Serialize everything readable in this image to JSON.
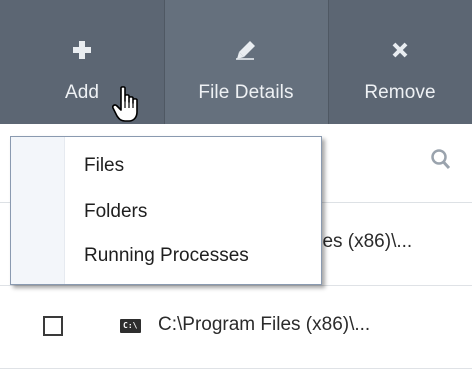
{
  "toolbar": {
    "add_label": "Add",
    "details_label": "File Details",
    "remove_label": "Remove"
  },
  "dropdown": {
    "items": [
      "Files",
      "Folders",
      "Running Processes"
    ]
  },
  "list": {
    "rows": [
      {
        "path": "iles (x86)\\..."
      },
      {
        "path": "C:\\Program Files (x86)\\..."
      }
    ],
    "cmd_icon_text": "C:\\"
  },
  "icons": {
    "add": "plus-icon",
    "details": "pencil-icon",
    "remove": "x-icon",
    "search": "search-icon",
    "row": "command-prompt-icon",
    "cursor": "hand-pointer-cursor"
  },
  "colors": {
    "toolbar_bg": "#5c6673",
    "toolbar_hover_bg": "#65707d",
    "toolbar_text": "#eef1f4",
    "menu_border": "#8a9ab0",
    "search_icon": "#9aa3ad"
  }
}
